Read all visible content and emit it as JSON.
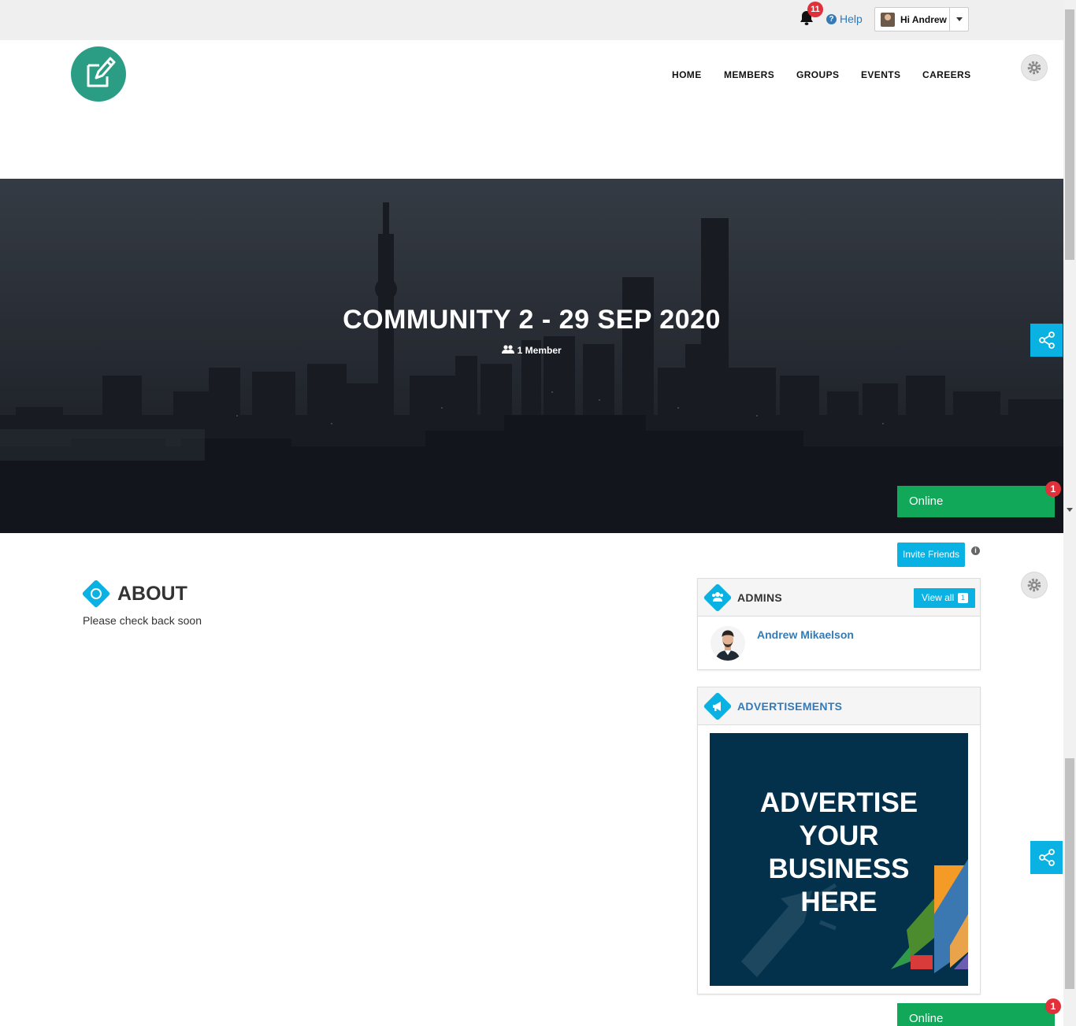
{
  "topbar": {
    "notification_count": "11",
    "help_label": "Help",
    "user_greeting": "Hi Andrew"
  },
  "nav": {
    "items": [
      "HOME",
      "MEMBERS",
      "GROUPS",
      "EVENTS",
      "CAREERS"
    ]
  },
  "hero": {
    "title": "COMMUNITY 2 - 29 SEP 2020",
    "members": "1 Member"
  },
  "chat": {
    "online_label": "Online",
    "unread_count": "1"
  },
  "actions": {
    "invite_label": "Invite Friends"
  },
  "about": {
    "title": "ABOUT",
    "text": "Please check back soon"
  },
  "admins": {
    "title": "ADMINS",
    "view_all_label": "View all",
    "count": "1",
    "items": [
      {
        "name": "Andrew Mikaelson"
      }
    ]
  },
  "ads": {
    "title": "ADVERTISEMENTS",
    "banner_lines": [
      "ADVERTISE",
      "YOUR",
      "BUSINESS",
      "HERE"
    ]
  },
  "colors": {
    "accent": "#0ab1e3",
    "brand": "#2a9d84",
    "online": "#12a85a",
    "badge": "#e0303a",
    "link": "#337ab7"
  },
  "icons": [
    "bell-icon",
    "help-icon",
    "caret-down-icon",
    "logo-icon",
    "gear-icon",
    "users-icon",
    "share-icon",
    "info-icon",
    "megaphone-icon"
  ]
}
